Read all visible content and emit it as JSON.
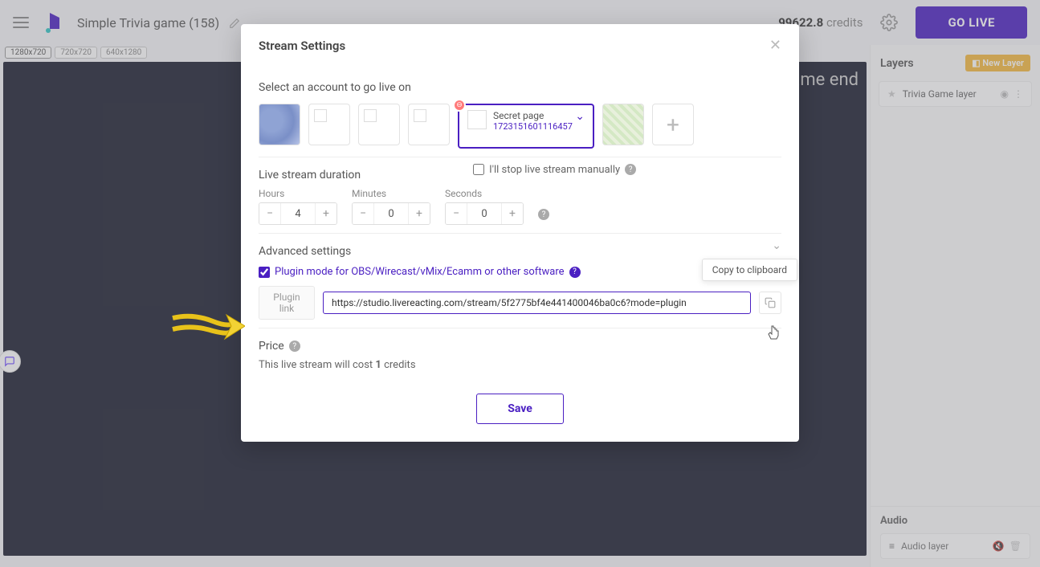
{
  "header": {
    "project_title": "Simple Trivia game (158)",
    "credits_value": "99622.8",
    "credits_label": "credits",
    "go_live": "GO LIVE"
  },
  "resolutions": [
    "1280x720",
    "720x720",
    "640x1280"
  ],
  "preview_overlay_text": "ame end",
  "layers": {
    "title": "Layers",
    "new_layer": "New Layer",
    "items": [
      {
        "name": "Trivia Game layer"
      }
    ]
  },
  "audio": {
    "title": "Audio",
    "items": [
      {
        "name": "Audio layer"
      }
    ]
  },
  "modal": {
    "title": "Stream Settings",
    "accounts_label": "Select an account to go live on",
    "selected_account": {
      "name": "Secret page",
      "id": "1723151601116457"
    },
    "duration": {
      "label": "Live stream duration",
      "manual_label": "I'll stop live stream manually",
      "hours_label": "Hours",
      "hours": "4",
      "minutes_label": "Minutes",
      "minutes": "0",
      "seconds_label": "Seconds",
      "seconds": "0"
    },
    "advanced": {
      "label": "Advanced settings",
      "plugin_label": "Plugin mode for OBS/Wirecast/vMix/Ecamm or other software",
      "plugin_link_label": "Plugin link",
      "plugin_link_value": "https://studio.livereacting.com/stream/5f2775bf4e441400046ba0c6?mode=plugin",
      "copy_tooltip": "Copy to clipboard"
    },
    "price": {
      "label": "Price",
      "text_pre": "This live stream will cost ",
      "cost": "1",
      "text_post": " credits"
    },
    "save": "Save"
  }
}
